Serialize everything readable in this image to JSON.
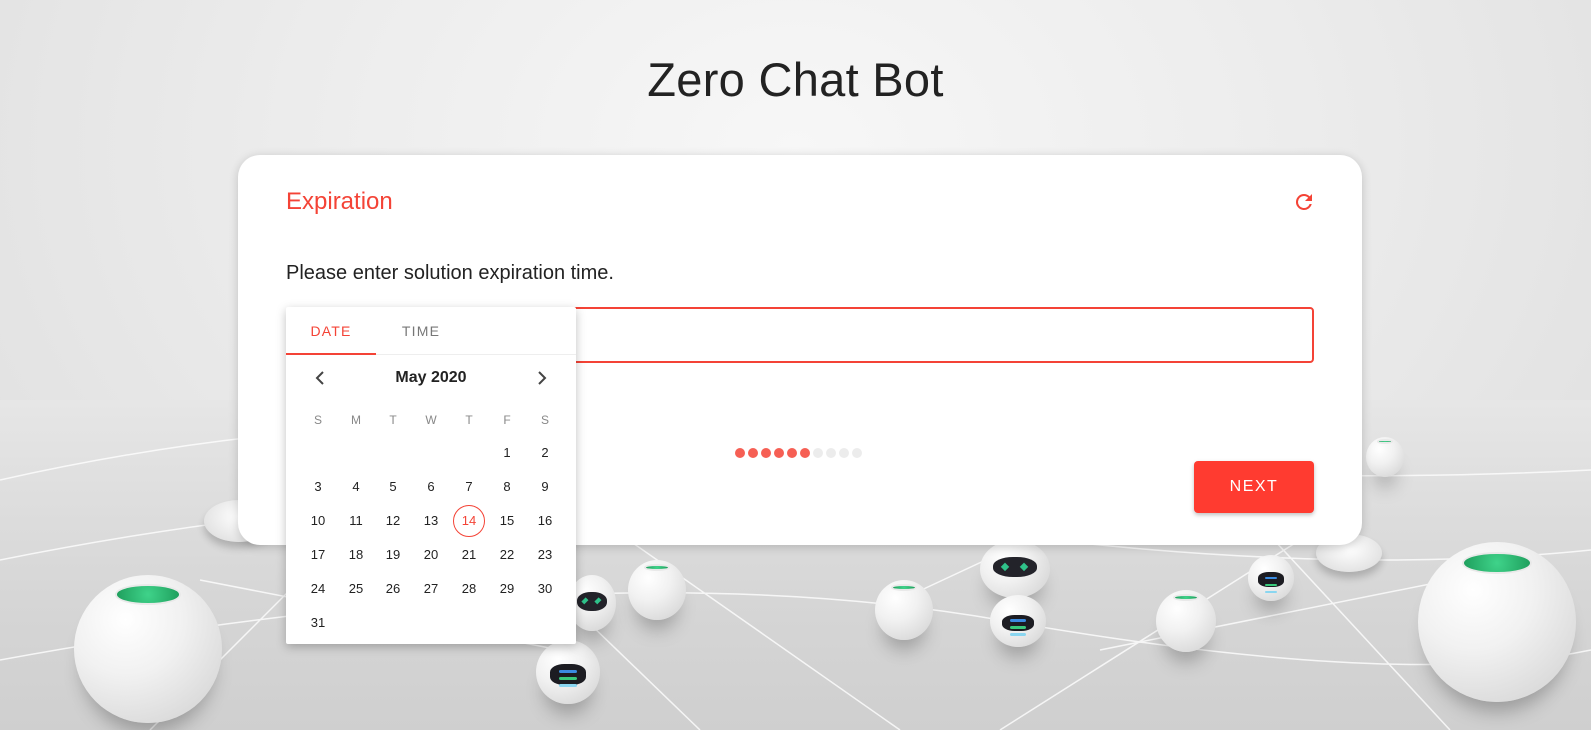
{
  "page": {
    "title": "Zero Chat Bot"
  },
  "card": {
    "title": "Expiration",
    "refresh_icon": "refresh-icon",
    "prompt": "Please enter solution expiration time.",
    "input_value": "",
    "next_label": "NEXT",
    "progress": {
      "completed": 6,
      "total": 10
    }
  },
  "picker": {
    "tabs": {
      "date": "DATE",
      "time": "TIME"
    },
    "month_label": "May 2020",
    "prev_icon": "chevron-left-icon",
    "next_icon": "chevron-right-icon",
    "weekdays": [
      "S",
      "M",
      "T",
      "W",
      "T",
      "F",
      "S"
    ],
    "first_weekday_index": 5,
    "days": [
      "1",
      "2",
      "3",
      "4",
      "5",
      "6",
      "7",
      "8",
      "9",
      "10",
      "11",
      "12",
      "13",
      "14",
      "15",
      "16",
      "17",
      "18",
      "19",
      "20",
      "21",
      "22",
      "23",
      "24",
      "25",
      "26",
      "27",
      "28",
      "29",
      "30",
      "31"
    ],
    "today": "14"
  },
  "colors": {
    "accent": "#f44336",
    "button": "#ff3b30"
  }
}
